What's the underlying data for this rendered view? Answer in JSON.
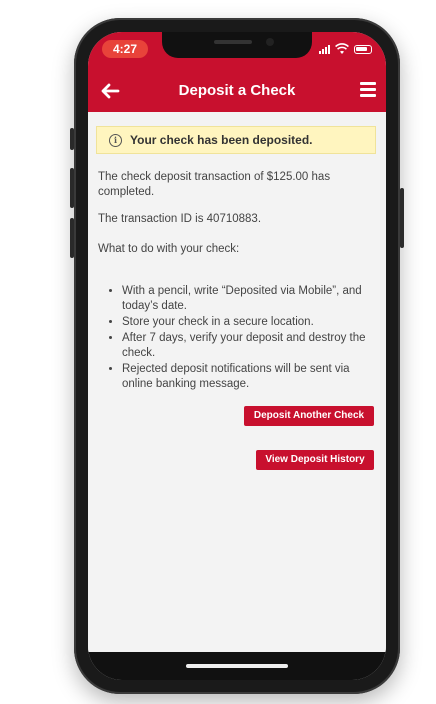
{
  "status_bar": {
    "time": "4:27"
  },
  "header": {
    "title": "Deposit a Check",
    "back_icon": "back-arrow-icon",
    "menu_icon": "hamburger-menu-icon"
  },
  "alert": {
    "icon": "info-icon",
    "icon_glyph": "i",
    "message": "Your check has been deposited."
  },
  "content": {
    "completed_text": "The check deposit transaction of $125.00 has completed.",
    "transaction_text": "The transaction ID is 40710883.",
    "instructions_heading": "What to do with your check:",
    "instructions": [
      "With a pencil, write “Deposited via Mobile”, and today’s date.",
      "Store your check in a secure location.",
      "After 7 days, verify your deposit and destroy the check.",
      "Rejected deposit notifications will be sent via online banking message."
    ]
  },
  "actions": {
    "deposit_another_label": "Deposit Another Check",
    "view_history_label": "View Deposit History"
  },
  "colors": {
    "brand_red": "#c8102e",
    "alert_bg": "#fff5bf",
    "time_pill": "#e8433a"
  }
}
